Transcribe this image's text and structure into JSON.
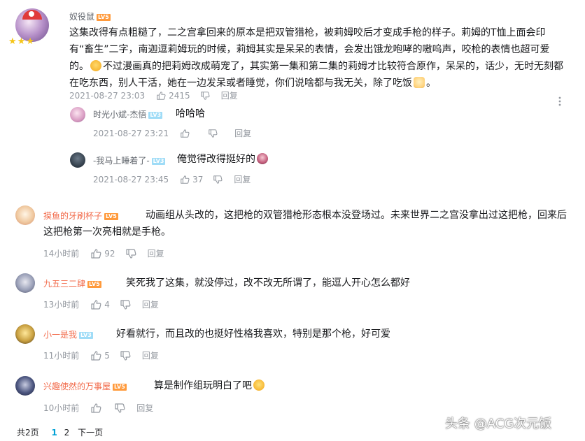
{
  "comment_main": {
    "user": "奴役鼠",
    "level": "LV5",
    "text": "这集改得有点粗糙了，二之宫拿回来的原本是把双管猎枪，被莉姆咬后才变成手枪的样子。莉姆的T恤上面会印有“畜生”二字，南迦逗莉姆玩的时候，莉姆其实是呆呆的表情，会发出饿龙咆哮的嗷呜声，咬枪的表情也超可爱的。",
    "text_2": "不过漫画真的把莉姆改成萌宠了，其实第一集和第二集的莉姆才比较符合原作，呆呆的，话少，无时无刻都在吃东西，别人干活，她在一边发呆或者睡觉，你们说啥都与我无关，除了吃饭",
    "text_end": "。",
    "time": "2021-08-27 23:03",
    "likes": "2415",
    "reply": "回复"
  },
  "replies": [
    {
      "user": "时光小斌-杰悟",
      "level": "LV3",
      "text": "哈哈哈",
      "time": "2021-08-27 23:21",
      "likes": "",
      "reply": "回复"
    },
    {
      "user": "-我马上睡着了-",
      "level": "LV3",
      "text": "俺觉得改得挺好的",
      "time": "2021-08-27 23:45",
      "likes": "37",
      "reply": "回复"
    }
  ],
  "comments": [
    {
      "user": "摸鱼的牙刷杯子",
      "level": "LV5",
      "text": "动画组从头改的，这把枪的双管猎枪形态根本没登场过。未来世界二之宫没拿出过这把枪，回来后这把枪第一次亮相就是手枪。",
      "time": "14小时前",
      "likes": "92",
      "reply": "回复"
    },
    {
      "user": "九五三二肆",
      "level": "LV5",
      "text": "笑死我了这集，就没停过，改不改无所谓了，能逗人开心怎么都好",
      "time": "13小时前",
      "likes": "4",
      "reply": "回复"
    },
    {
      "user": "小一是我",
      "level": "LV3",
      "text": "好看就行，而且改的也挺好性格我喜欢，特别是那个枪，好可爱",
      "time": "11小时前",
      "likes": "5",
      "reply": "回复"
    },
    {
      "user": "兴趣使然的万事屋",
      "level": "LV5",
      "text": "算是制作组玩明白了吧",
      "time": "10小时前",
      "likes": "",
      "reply": "回复"
    }
  ],
  "pagination": {
    "total": "共2页",
    "page1": "1",
    "page2": "2",
    "next": "下一页"
  },
  "watermark": "头条 @ACG次元饭",
  "colors": {
    "accent": "#00a1d6",
    "orange_name": "#fb7299",
    "meta": "#9499a0",
    "lv5": "#ff9a3c",
    "lv3": "#9fdcf7",
    "name_red": "#f26b4b"
  },
  "icons": [
    "thumbs-up-icon",
    "thumbs-down-icon",
    "more-vertical-icon",
    "emoji-icon"
  ]
}
